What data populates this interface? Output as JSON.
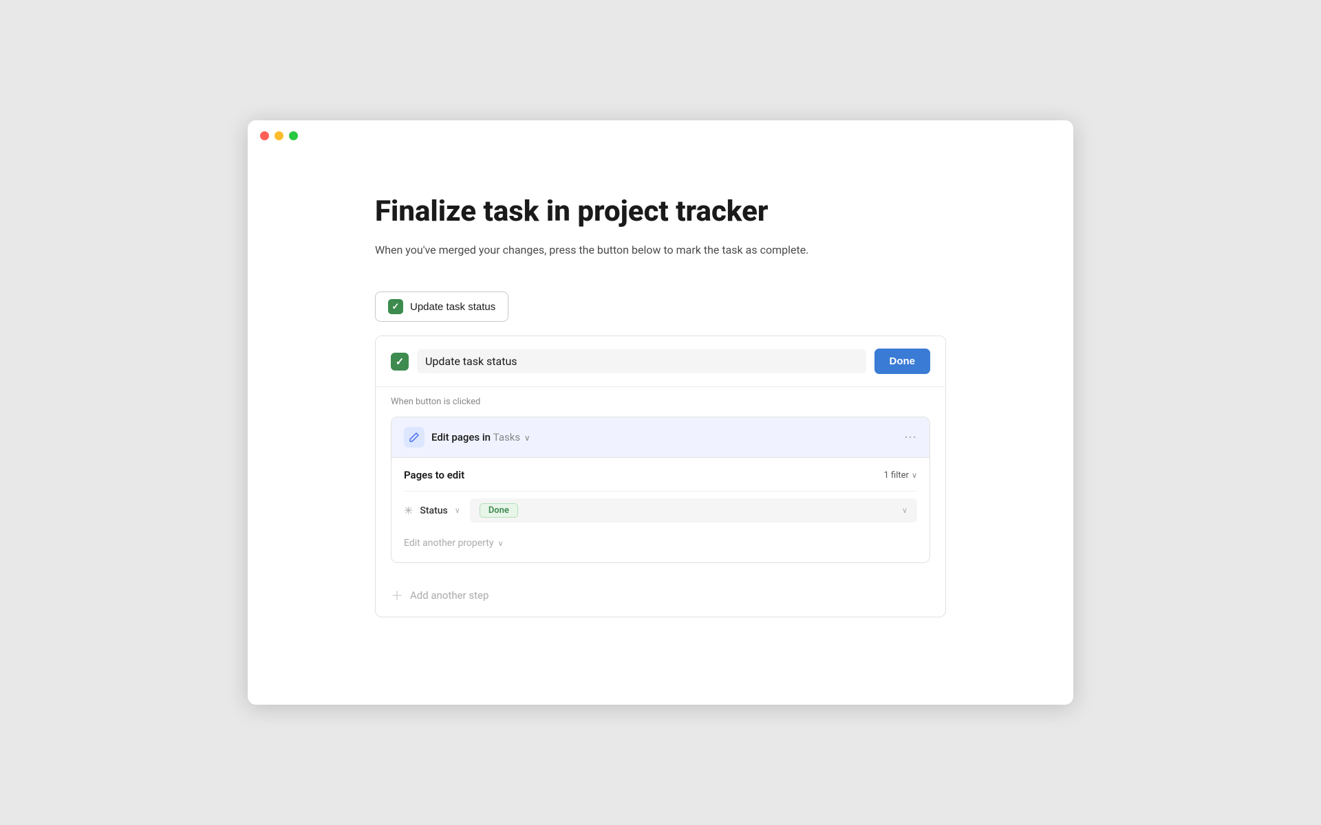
{
  "window": {
    "title": "Finalize task in project tracker"
  },
  "titlebar": {
    "red": "close",
    "yellow": "minimize",
    "green": "maximize"
  },
  "page": {
    "title": "Finalize task in project tracker",
    "description": "When you've merged your changes, press the button below to mark the task as complete.",
    "update_button_label": "Update task status",
    "card": {
      "checkbox_checked": true,
      "title_input_value": "Update task status",
      "done_button_label": "Done",
      "trigger_label": "When button is clicked",
      "step": {
        "icon": "✏",
        "title_prefix": "Edit pages in",
        "db_name": "Tasks",
        "more_icon": "···",
        "pages_label": "Pages to edit",
        "filter_label": "1 filter",
        "status_label": "Status",
        "done_badge": "Done",
        "edit_property_label": "Edit another property"
      },
      "add_step_label": "Add another step"
    }
  }
}
